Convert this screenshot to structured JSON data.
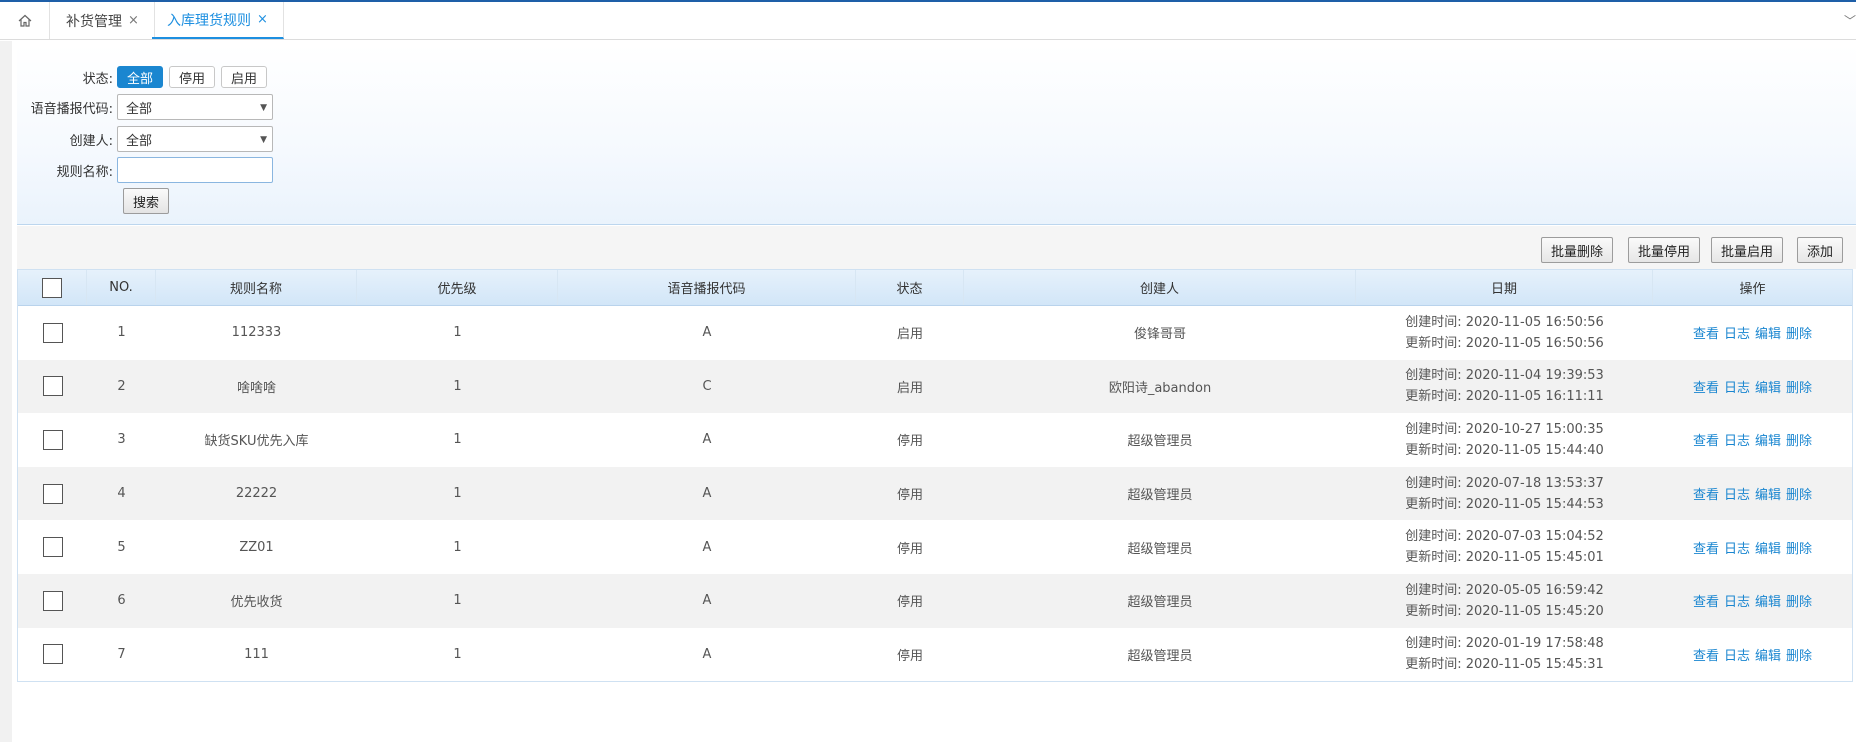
{
  "tabs": {
    "items": [
      {
        "label": "补货管理",
        "close": "×"
      },
      {
        "label": "入库理货规则",
        "close": "×"
      }
    ],
    "scroll_glyph": "﹀"
  },
  "filters": {
    "status_label": "状态:",
    "status_options": [
      "全部",
      "停用",
      "启用"
    ],
    "voice_label": "语音播报代码:",
    "voice_value": "全部",
    "creator_label": "创建人:",
    "creator_value": "全部",
    "rule_name_label": "规则名称:",
    "rule_name_value": "",
    "search_label": "搜索"
  },
  "toolbar": {
    "batch_delete": "批量删除",
    "batch_disable": "批量停用",
    "batch_enable": "批量启用",
    "add": "添加"
  },
  "table": {
    "headers": [
      "NO.",
      "规则名称",
      "优先级",
      "语音播报代码",
      "状态",
      "创建人",
      "日期",
      "操作"
    ],
    "created_prefix": "创建时间:",
    "updated_prefix": "更新时间:",
    "actions": [
      "查看",
      "日志",
      "编辑",
      "删除"
    ],
    "rows": [
      {
        "no": "1",
        "name": "112333",
        "priority": "1",
        "voice": "A",
        "status": "启用",
        "creator": "俊锋哥哥",
        "created": "2020-11-05 16:50:56",
        "updated": "2020-11-05 16:50:56"
      },
      {
        "no": "2",
        "name": "啥啥啥",
        "priority": "1",
        "voice": "C",
        "status": "启用",
        "creator": "欧阳诗_abandon",
        "created": "2020-11-04 19:39:53",
        "updated": "2020-11-05 16:11:11"
      },
      {
        "no": "3",
        "name": "缺货SKU优先入库",
        "priority": "1",
        "voice": "A",
        "status": "停用",
        "creator": "超级管理员",
        "created": "2020-10-27 15:00:35",
        "updated": "2020-11-05 15:44:40"
      },
      {
        "no": "4",
        "name": "22222",
        "priority": "1",
        "voice": "A",
        "status": "停用",
        "creator": "超级管理员",
        "created": "2020-07-18 13:53:37",
        "updated": "2020-11-05 15:44:53"
      },
      {
        "no": "5",
        "name": "ZZ01",
        "priority": "1",
        "voice": "A",
        "status": "停用",
        "creator": "超级管理员",
        "created": "2020-07-03 15:04:52",
        "updated": "2020-11-05 15:45:01"
      },
      {
        "no": "6",
        "name": "优先收货",
        "priority": "1",
        "voice": "A",
        "status": "停用",
        "creator": "超级管理员",
        "created": "2020-05-05 16:59:42",
        "updated": "2020-11-05 15:45:20"
      },
      {
        "no": "7",
        "name": "111",
        "priority": "1",
        "voice": "A",
        "status": "停用",
        "creator": "超级管理员",
        "created": "2020-01-19 17:58:48",
        "updated": "2020-11-05 15:45:31"
      }
    ]
  },
  "colors": {
    "accent": "#1a86d0",
    "tab_active": "#1d8fe0",
    "top_line": "#1e5fa8"
  }
}
